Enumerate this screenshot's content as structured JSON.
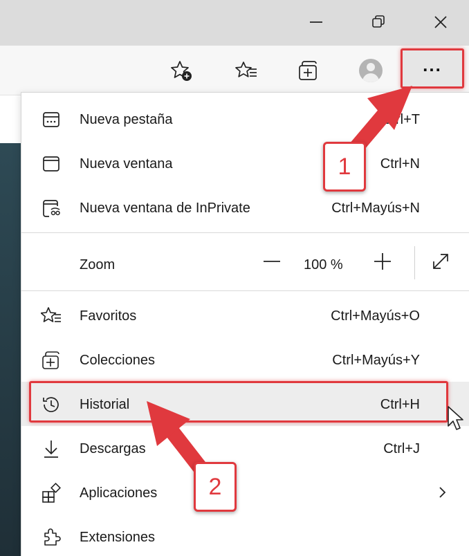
{
  "window": {
    "minimize_icon": "minimize-icon",
    "restore_icon": "restore-icon",
    "close_icon": "close-icon"
  },
  "toolbar": {
    "add_favorite_icon": "star-plus-icon",
    "favorites_icon": "favorites-list-icon",
    "collections_icon": "collections-icon",
    "profile_icon": "avatar-icon",
    "more_label": "..."
  },
  "menu": {
    "items": [
      {
        "label": "Nueva pestaña",
        "shortcut": "Ctrl+T",
        "icon": "new-tab-icon"
      },
      {
        "label": "Nueva ventana",
        "shortcut": "Ctrl+N",
        "icon": "new-window-icon"
      },
      {
        "label": "Nueva ventana de InPrivate",
        "shortcut": "Ctrl+Mayús+N",
        "icon": "inprivate-icon"
      }
    ],
    "zoom": {
      "label": "Zoom",
      "value": "100 %"
    },
    "items2": [
      {
        "label": "Favoritos",
        "shortcut": "Ctrl+Mayús+O",
        "icon": "favorites-icon"
      },
      {
        "label": "Colecciones",
        "shortcut": "Ctrl+Mayús+Y",
        "icon": "collections-icon"
      },
      {
        "label": "Historial",
        "shortcut": "Ctrl+H",
        "icon": "history-icon"
      },
      {
        "label": "Descargas",
        "shortcut": "Ctrl+J",
        "icon": "download-icon"
      },
      {
        "label": "Aplicaciones",
        "shortcut": "",
        "icon": "apps-icon"
      },
      {
        "label": "Extensiones",
        "shortcut": "",
        "icon": "extensions-icon"
      }
    ]
  },
  "annotations": {
    "step1": "1",
    "step2": "2",
    "highlight_color": "#e0393e"
  }
}
